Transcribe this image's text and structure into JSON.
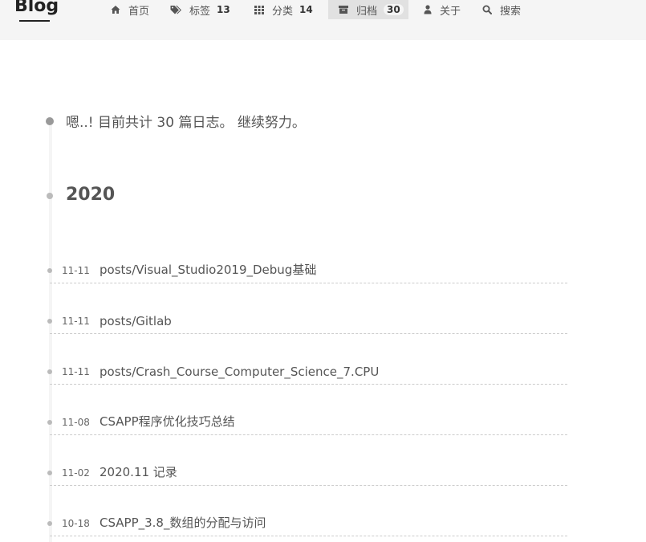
{
  "header": {
    "brand": "Blog",
    "menu": [
      {
        "label": "首页",
        "icon": "home-icon",
        "count": ""
      },
      {
        "label": "标签",
        "icon": "tags-icon",
        "count": "13"
      },
      {
        "label": "分类",
        "icon": "grid-icon",
        "count": "14"
      },
      {
        "label": "归档",
        "icon": "archive-icon",
        "count": "30",
        "active": true
      },
      {
        "label": "关于",
        "icon": "user-icon",
        "count": ""
      },
      {
        "label": "搜索",
        "icon": "search-icon",
        "count": ""
      }
    ]
  },
  "archive": {
    "intro": "嗯..! 目前共计 30 篇日志。 继续努力。",
    "year": "2020",
    "posts": [
      {
        "date": "11-11",
        "title": "posts/Visual_Studio2019_Debug基础"
      },
      {
        "date": "11-11",
        "title": "posts/Gitlab"
      },
      {
        "date": "11-11",
        "title": "posts/Crash_Course_Computer_Science_7.CPU"
      },
      {
        "date": "11-08",
        "title": "CSAPP程序优化技巧总结"
      },
      {
        "date": "11-02",
        "title": "2020.11 记录"
      },
      {
        "date": "10-18",
        "title": "CSAPP_3.8_数组的分配与访问"
      }
    ]
  },
  "colors": {
    "header_bg": "#f5f5f5",
    "active_bg": "#e1e1e1",
    "text": "#555555",
    "brand": "#222222"
  }
}
